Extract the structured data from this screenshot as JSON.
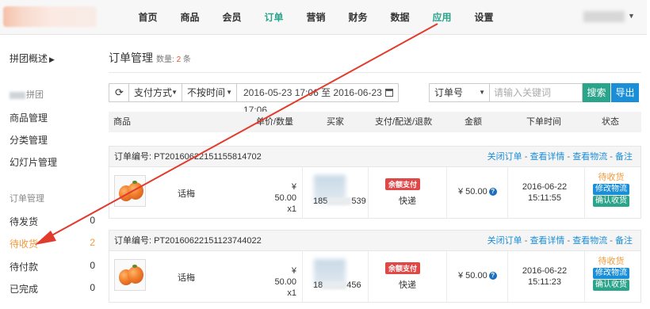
{
  "nav": {
    "items": [
      "首页",
      "商品",
      "会员",
      "订单",
      "营销",
      "财务",
      "数据",
      "应用",
      "设置"
    ],
    "active_index": 3
  },
  "sidebar": {
    "title": "拼团概述",
    "group1_label": "拼团",
    "group1_items": [
      "商品管理",
      "分类管理",
      "幻灯片管理"
    ],
    "group2_label": "订单管理",
    "order_items": [
      {
        "label": "待发货",
        "count": "0"
      },
      {
        "label": "待收货",
        "count": "2"
      },
      {
        "label": "待付款",
        "count": "0"
      },
      {
        "label": "已完成",
        "count": "0"
      }
    ]
  },
  "page": {
    "title": "订单管理",
    "count_label": "数量:",
    "count": "2",
    "count_unit": "条"
  },
  "filters": {
    "refresh_icon": "⟳",
    "pay_method": "支付方式",
    "time_filter": "不按时间",
    "date_range": "2016-05-23 17:06 至 2016-06-23 17:06",
    "search_field": "订单号",
    "search_placeholder": "请输入关键词",
    "search_button": "搜索",
    "export_button": "导出"
  },
  "table": {
    "headers": [
      "商品",
      "单价/数量",
      "买家",
      "支付/配送/退款",
      "金额",
      "下单时间",
      "状态"
    ]
  },
  "orders": [
    {
      "order_no_label": "订单编号:",
      "order_no": "PT20160622151155814702",
      "links": [
        "关闭订单",
        "查看详情",
        "查看物流",
        "备注"
      ],
      "product": "话梅",
      "price": "¥ 50.00",
      "qty": "x1",
      "phone_start": "185",
      "phone_end": "539",
      "pay_badge": "余额支付",
      "delivery": "快递",
      "amount": "¥ 50.00",
      "date": "2016-06-22",
      "time": "15:11:55",
      "status": "待收货",
      "btn_logistics": "修改物流",
      "btn_confirm": "确认收货"
    },
    {
      "order_no_label": "订单编号:",
      "order_no": "PT20160622151123744022",
      "links": [
        "关闭订单",
        "查看详情",
        "查看物流",
        "备注"
      ],
      "product": "话梅",
      "price": "¥ 50.00",
      "qty": "x1",
      "phone_start": "18",
      "phone_end": "456",
      "pay_badge": "余额支付",
      "delivery": "快递",
      "amount": "¥ 50.00",
      "date": "2016-06-22",
      "time": "15:11:23",
      "status": "待收货",
      "btn_logistics": "修改物流",
      "btn_confirm": "确认收货"
    }
  ],
  "colors": {
    "accent_green": "#2aa48a",
    "accent_blue": "#1b8ed8",
    "status_orange": "#f29a3b",
    "badge_red": "#e04848",
    "annotation_red": "#e23a2c"
  }
}
